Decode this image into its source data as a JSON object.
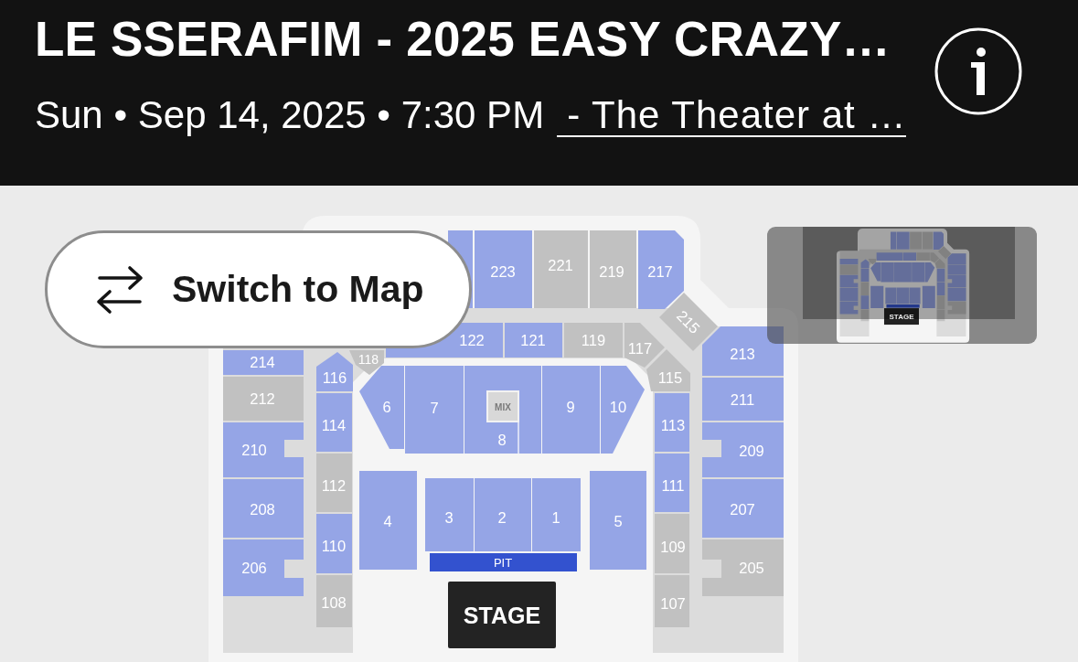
{
  "event": {
    "title": "LE SSERAFIM - 2025 EASY CRAZY…",
    "date_time": "Sun • Sep 14, 2025 • 7:30 PM",
    "venue_link": "- The Theater at …"
  },
  "map": {
    "switch_button": {
      "label": "Switch to Map"
    },
    "sections": [
      {
        "available": true
      },
      {
        "label": "223",
        "available": true
      },
      {
        "label": "221",
        "available": false
      },
      {
        "label": "219",
        "available": false
      },
      {
        "label": "217",
        "available": true
      },
      {
        "label": "215",
        "available": false
      },
      {
        "label": "213",
        "available": true
      },
      {
        "label": "211",
        "available": true
      },
      {
        "label": "209",
        "available": true
      },
      {
        "label": "207",
        "available": true
      },
      {
        "label": "205",
        "available": false
      },
      {
        "label": "214",
        "available": true
      },
      {
        "label": "212",
        "available": false
      },
      {
        "label": "210",
        "available": true
      },
      {
        "label": "208",
        "available": true
      },
      {
        "label": "206",
        "available": true
      },
      {
        "label": "122",
        "available": true
      },
      {
        "label": "121",
        "available": true
      },
      {
        "label": "119",
        "available": false
      },
      {
        "label": "117",
        "available": false
      },
      {
        "label": "115",
        "available": false
      },
      {
        "label": "113",
        "available": true
      },
      {
        "label": "111",
        "available": true
      },
      {
        "label": "109",
        "available": false
      },
      {
        "label": "107",
        "available": false
      },
      {
        "label": "116",
        "available": true
      },
      {
        "label": "118",
        "available": false
      },
      {
        "label": "114",
        "available": true
      },
      {
        "label": "112",
        "available": false
      },
      {
        "label": "110",
        "available": true
      },
      {
        "label": "108",
        "available": false
      },
      {
        "label": "6",
        "available": true
      },
      {
        "label": "7",
        "available": true
      },
      {
        "label": "8",
        "available": true
      },
      {
        "label": "9",
        "available": true
      },
      {
        "label": "10",
        "available": true
      },
      {
        "label": "4",
        "available": true
      },
      {
        "label": "3",
        "available": true
      },
      {
        "label": "2",
        "available": true
      },
      {
        "label": "1",
        "available": true
      },
      {
        "label": "5",
        "available": true
      }
    ],
    "mix": {
      "label": "MIX"
    },
    "pit": {
      "label": "PIT"
    },
    "stage": {
      "label": "STAGE"
    }
  },
  "minimap": {
    "stage_label": "STAGE"
  }
}
